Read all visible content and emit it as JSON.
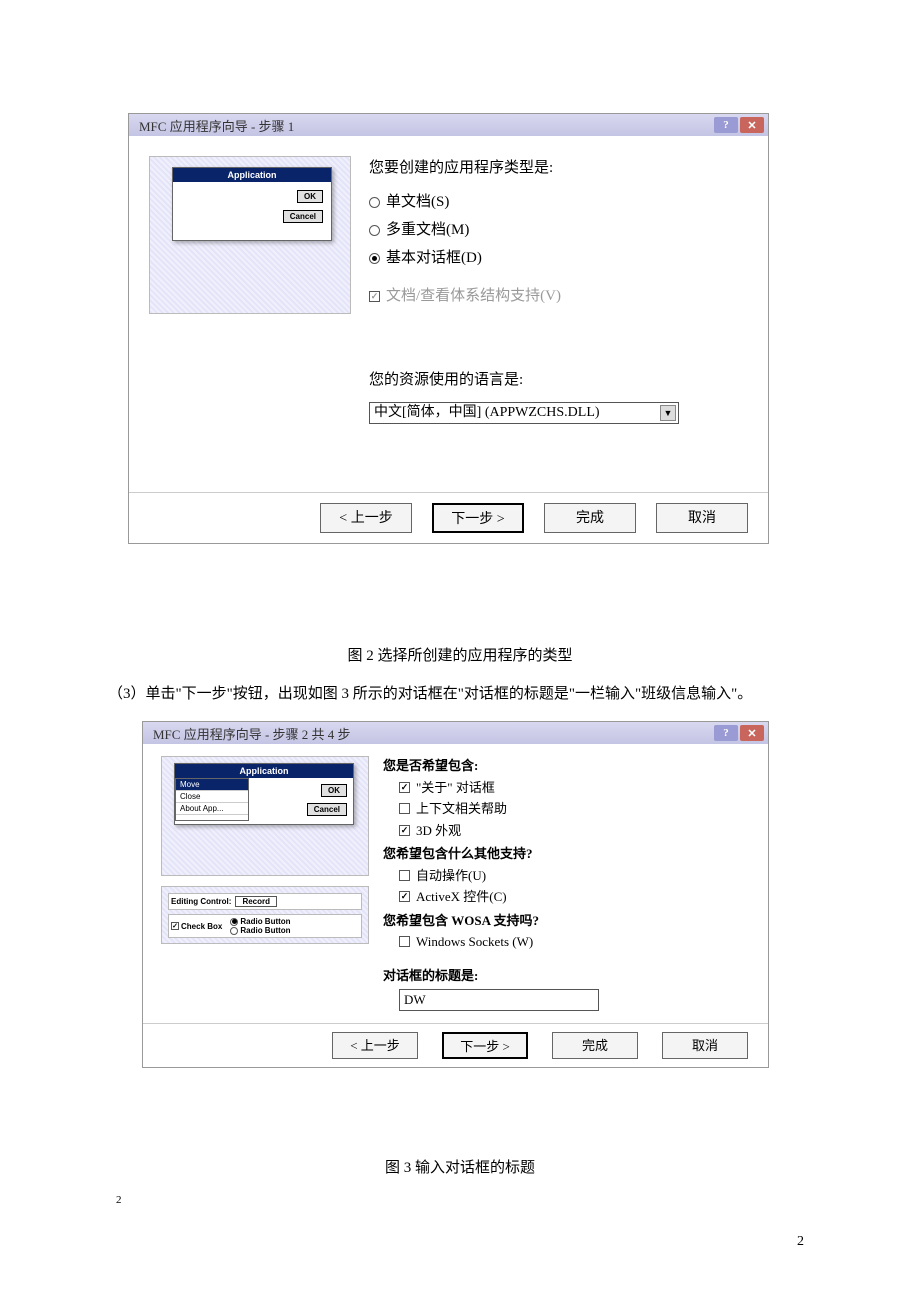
{
  "dialog1": {
    "title": "MFC 应用程序向导 - 步骤 1",
    "preview": {
      "header": "Application",
      "ok": "OK",
      "cancel": "Cancel"
    },
    "q1": "您要创建的应用程序类型是:",
    "opt_single": "单文档(S)",
    "opt_multi": "多重文档(M)",
    "opt_dialog": "基本对话框(D)",
    "chk_docview": "文档/查看体系结构支持(V)",
    "q2": "您的资源使用的语言是:",
    "lang_value": "中文[简体，中国] (APPWZCHS.DLL)",
    "btn_back": "< 上一步",
    "btn_next": "下一步 >",
    "btn_finish": "完成",
    "btn_cancel": "取消"
  },
  "caption1": "图 2 选择所创建的应用程序的类型",
  "para1": "（3）单击\"下一步\"按钮，出现如图 3 所示的对话框在\"对话框的标题是\"一栏输入\"班级信息输入\"。",
  "dialog2": {
    "title": "MFC 应用程序向导 - 步骤 2 共 4 步",
    "preview": {
      "header": "Application",
      "menu_move": "Move",
      "menu_close": "Close",
      "menu_about": "About App...",
      "ok": "OK",
      "cancel": "Cancel",
      "editing_label": "Editing Control:",
      "editing_value": "Record",
      "check_label": "Check Box",
      "radio_label": "Radio Button"
    },
    "q1": "您是否希望包含:",
    "chk_about": "\"关于\" 对话框",
    "chk_context": "上下文相关帮助",
    "chk_3d": "3D 外观",
    "q2": "您希望包含什么其他支持?",
    "chk_auto": "自动操作(U)",
    "chk_activex": "ActiveX 控件(C)",
    "q3": "您希望包含 WOSA 支持吗?",
    "chk_sockets": "Windows Sockets (W)",
    "q4": "对话框的标题是:",
    "title_value": "DW",
    "btn_back": "< 上一步",
    "btn_next": "下一步 >",
    "btn_finish": "完成",
    "btn_cancel": "取消"
  },
  "caption2": "图 3 输入对话框的标题",
  "page_left": "2",
  "page_right": "2"
}
